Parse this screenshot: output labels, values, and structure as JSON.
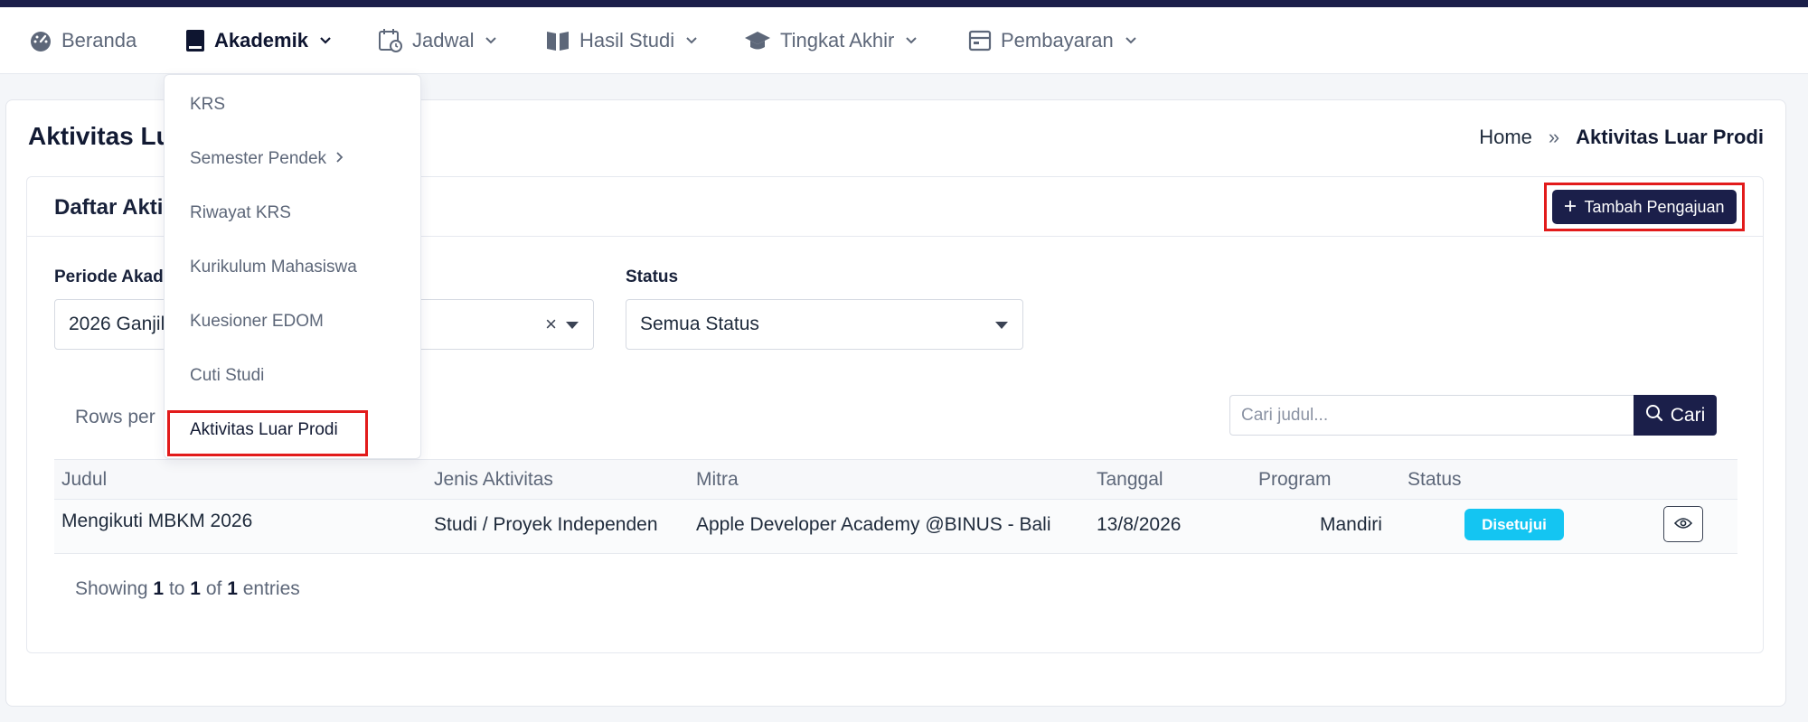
{
  "nav": {
    "items": [
      {
        "label": "Beranda",
        "icon": "gauge-icon"
      },
      {
        "label": "Akademik",
        "icon": "book-icon"
      },
      {
        "label": "Jadwal",
        "icon": "calendar-icon"
      },
      {
        "label": "Hasil Studi",
        "icon": "book-open-icon"
      },
      {
        "label": "Tingkat Akhir",
        "icon": "graduation-cap-icon"
      },
      {
        "label": "Pembayaran",
        "icon": "wallet-icon"
      }
    ],
    "active": "Akademik",
    "accent_color": "#1b1f4a"
  },
  "dropdown": {
    "items": [
      {
        "label": "KRS"
      },
      {
        "label": "Semester Pendek"
      },
      {
        "label": "Riwayat KRS"
      },
      {
        "label": "Kurikulum Mahasiswa"
      },
      {
        "label": "Kuesioner EDOM"
      },
      {
        "label": "Cuti Studi"
      },
      {
        "label": "Aktivitas Luar Prodi"
      }
    ],
    "active": "Aktivitas Luar Prodi"
  },
  "page": {
    "title": "Aktivitas Lu",
    "breadcrumb": {
      "home": "Home",
      "separator": "»",
      "current": "Aktivitas Luar Prodi"
    }
  },
  "card": {
    "title": "Daftar Akti",
    "add_button": "Tambah Pengajuan",
    "add_button_icon": "plus-icon"
  },
  "filters": {
    "periode": {
      "label": "Periode Akad",
      "value": "2026 Ganjil",
      "clear": "×"
    },
    "status": {
      "label": "Status",
      "value": "Semua Status"
    }
  },
  "table_controls": {
    "rows_per_label": "Rows per",
    "search_placeholder": "Cari judul...",
    "search_button": "Cari"
  },
  "table": {
    "columns": [
      "Judul",
      "Jenis Aktivitas",
      "Mitra",
      "Tanggal",
      "Program",
      "Status"
    ],
    "rows": [
      {
        "judul": "Mengikuti MBKM 2026",
        "jenis": "Studi / Proyek Independen",
        "mitra": "Apple Developer Academy @BINUS - Bali",
        "tanggal": "13/8/2026",
        "program": "Mandiri",
        "status": "Disetujui",
        "status_color": "#14c5f2"
      }
    ]
  },
  "footer": {
    "showing_prefix": "Showing",
    "from": "1",
    "to_word": "to",
    "to": "1",
    "of_word": "of",
    "total": "1",
    "suffix": "entries"
  },
  "highlight_color": "#e21b1b"
}
